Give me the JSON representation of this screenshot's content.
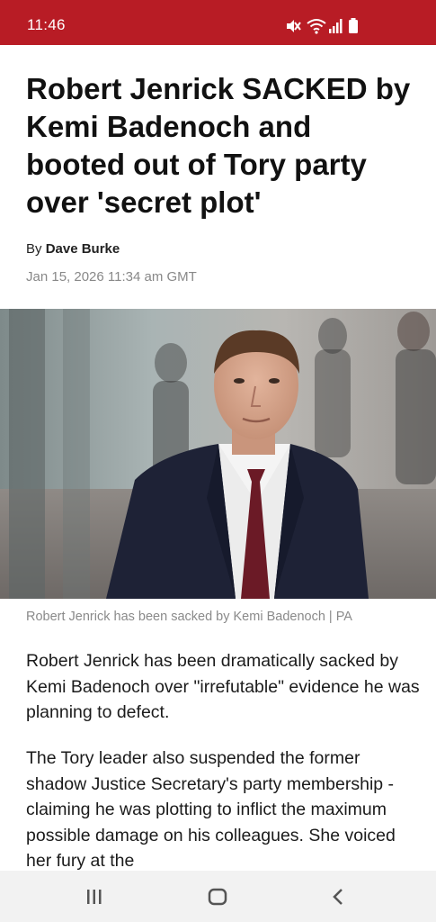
{
  "status_bar": {
    "time": "11:46",
    "icons": [
      "mute-icon",
      "wifi-icon",
      "signal-icon",
      "battery-icon"
    ],
    "background": "#b81c25"
  },
  "article": {
    "headline": "Robert Jenrick SACKED by Kemi Badenoch and booted out of Tory party over 'secret plot'",
    "byline_prefix": "By",
    "author": "Dave Burke",
    "date": "Jan 15, 2026 11:34 am GMT",
    "image_caption": "Robert Jenrick has been sacked by Kemi Badenoch | PA",
    "paragraphs": [
      "Robert Jenrick has been dramatically sacked by Kemi Badenoch over \"irrefutable\" evidence he was planning to defect.",
      "The Tory leader also suspended the former shadow Justice Secretary's party membership - claiming he was plotting to inflict the maximum possible damage on his colleagues. She voiced her fury at the"
    ]
  },
  "nav_bar": {
    "buttons": [
      "recent-apps-icon",
      "home-icon",
      "back-icon"
    ]
  }
}
